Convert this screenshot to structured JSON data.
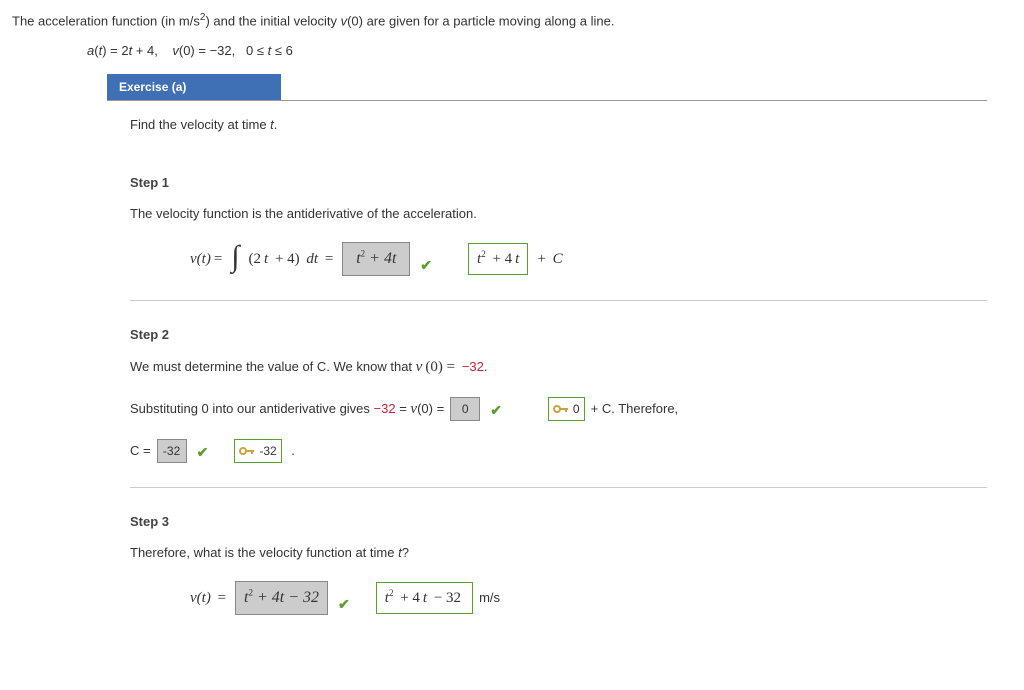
{
  "intro": "The acceleration function (in m/s²) and the initial velocity v(0) are given for a particle moving along a line.",
  "given_html": "a(t) = 2t + 4,   v(0) = −32,   0 ≤ t ≤ 6",
  "exercise_tab": "Exercise (a)",
  "prompt": "Find the velocity at time t.",
  "step1": {
    "title": "Step 1",
    "text": "The velocity function is the antiderivative of the acceleration.",
    "lhs": "v(t) =",
    "integrand": "(2t + 4) dt =",
    "input": "t² + 4t",
    "green": "t² + 4t",
    "tail": "+ C"
  },
  "step2": {
    "title": "Step 2",
    "text1": "We must determine the value of C. We know that v(0) = ",
    "neg32": "−32",
    "text2_a": "Substituting 0 into our antiderivative gives ",
    "text2_b": " = v(0) = ",
    "input0": "0",
    "green0": "0",
    "text2_c": " + C. Therefore,",
    "c_lhs": "C = ",
    "c_input": "-32",
    "c_green": "-32"
  },
  "step3": {
    "title": "Step 3",
    "text": "Therefore, what is the velocity function at time t?",
    "lhs": "v(t) = ",
    "input": "t² + 4t − 32",
    "green": "t² + 4t − 32",
    "unit": "m/s"
  }
}
